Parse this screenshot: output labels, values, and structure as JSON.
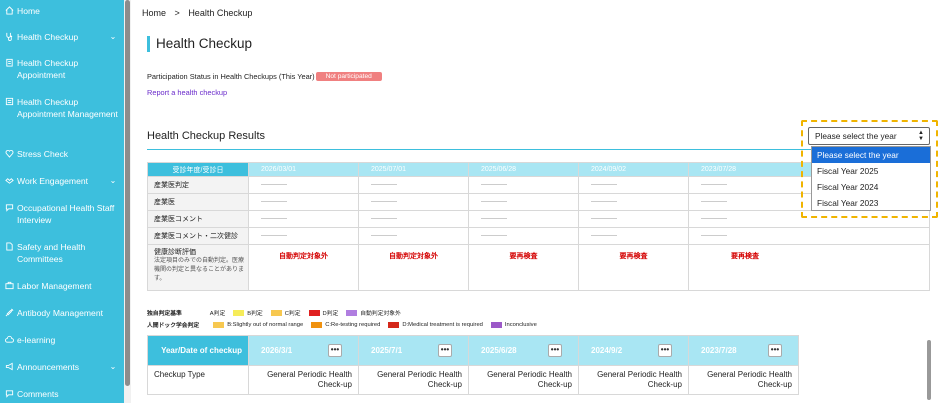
{
  "sidebar": {
    "items": [
      {
        "label": "Home",
        "icon": "home-icon",
        "expandable": false
      },
      {
        "label": "Health Checkup",
        "icon": "stethoscope-icon",
        "expandable": true
      },
      {
        "label": "Health Checkup Appointment",
        "icon": "clipboard-icon",
        "expandable": false
      },
      {
        "label": "Health Checkup Appointment Management",
        "icon": "list-icon",
        "expandable": false
      },
      {
        "label": "Stress Check",
        "icon": "heart-icon",
        "expandable": false
      },
      {
        "label": "Work Engagement",
        "icon": "handshake-icon",
        "expandable": true
      },
      {
        "label": "Occupational Health Staff Interview",
        "icon": "chat-icon",
        "expandable": false
      },
      {
        "label": "Safety and Health Committees",
        "icon": "document-icon",
        "expandable": false
      },
      {
        "label": "Labor Management",
        "icon": "briefcase-icon",
        "expandable": false
      },
      {
        "label": "Antibody Management",
        "icon": "syringe-icon",
        "expandable": false
      },
      {
        "label": "e-learning",
        "icon": "cloud-icon",
        "expandable": false
      },
      {
        "label": "Announcements",
        "icon": "megaphone-icon",
        "expandable": true
      },
      {
        "label": "Comments",
        "icon": "comment-icon",
        "expandable": false
      }
    ]
  },
  "breadcrumb": {
    "home": "Home",
    "sep": ">",
    "current": "Health Checkup"
  },
  "page_title": "Health Checkup",
  "participation": {
    "label": "Participation Status in Health Checkups (This Year)",
    "status": "Not participated"
  },
  "report_link": "Report a health checkup",
  "results_title": "Health Checkup Results",
  "year_select": {
    "value": "Please select the year",
    "options": [
      "Please select the year",
      "Fiscal Year 2025",
      "Fiscal Year 2024",
      "Fiscal Year 2023"
    ]
  },
  "table1": {
    "header_label": "受診年度/受診日",
    "dates": [
      "2026/03/01",
      "2025/07/01",
      "2025/06/28",
      "2024/09/02",
      "2023/07/28"
    ],
    "rows": [
      "産業医判定",
      "産業医",
      "産業医コメント",
      "産業医コメント・二次健診"
    ],
    "eval_label": "健康診断評価",
    "eval_sub": "法定項目のみでの自動判定。医療機関の判定と異なることがあります。",
    "eval_values": [
      "自動判定対象外",
      "自動判定対象外",
      "要再検査",
      "要再検査",
      "要再検査"
    ]
  },
  "legend1": {
    "title": "独自判定基準",
    "items": [
      {
        "label": "A判定",
        "color": "#ffffff"
      },
      {
        "label": "B判定",
        "color": "#f6ec5a"
      },
      {
        "label": "C判定",
        "color": "#f7c850"
      },
      {
        "label": "D判定",
        "color": "#e02020"
      },
      {
        "label": "自動判定対象外",
        "color": "#b07ee0"
      }
    ]
  },
  "legend2": {
    "title": "人間ドック学会判定",
    "items": [
      {
        "label": "B:Slightly out of normal range",
        "color": "#f7c850"
      },
      {
        "label": "C:Re-testing required",
        "color": "#f0920f"
      },
      {
        "label": "D:Medical treatment is required",
        "color": "#d4281a"
      },
      {
        "label": "Inconclusive",
        "color": "#9c59c8"
      }
    ]
  },
  "table2": {
    "header_label": "Year/Date of checkup",
    "dates": [
      "2026/3/1",
      "2025/7/1",
      "2025/6/28",
      "2024/9/2",
      "2023/7/28"
    ],
    "more_label": "•••",
    "row_label": "Checkup Type",
    "values": [
      "General Periodic Health Check-up",
      "General Periodic Health Check-up",
      "General Periodic Health Check-up",
      "General Periodic Health Check-up",
      "General Periodic Health Check-up"
    ]
  },
  "colors": {
    "accent": "#3dbfdd",
    "accent_light": "#a9e6f3",
    "alert": "#d40000",
    "badge": "#f08080",
    "link": "#6a2bcb"
  }
}
